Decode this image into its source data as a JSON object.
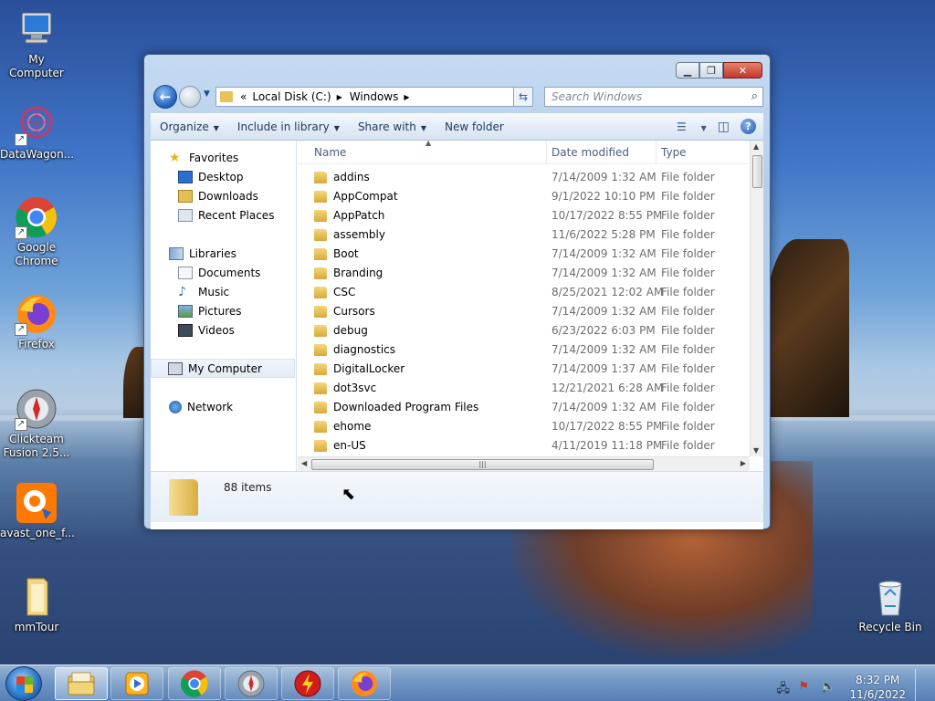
{
  "desktop": {
    "icons": [
      {
        "label": "My Computer",
        "icon": "computer-icon"
      },
      {
        "label": "DataWagon...",
        "icon": "datawagon-icon"
      },
      {
        "label": "Google Chrome",
        "icon": "chrome-icon"
      },
      {
        "label": "Firefox",
        "icon": "firefox-icon"
      },
      {
        "label": "Clickteam Fusion 2.5...",
        "icon": "clickteam-icon"
      },
      {
        "label": "avast_one_f...",
        "icon": "avast-icon"
      },
      {
        "label": "mmTour",
        "icon": "folder-icon"
      },
      {
        "label": "Recycle Bin",
        "icon": "recycle-bin-icon"
      }
    ]
  },
  "window": {
    "breadcrumb": {
      "root_chevron": "«",
      "parts": [
        "Local Disk (C:)",
        "Windows"
      ]
    },
    "search_placeholder": "Search Windows",
    "toolbar": {
      "organize": "Organize",
      "include_in_library": "Include in library",
      "share_with": "Share with",
      "new_folder": "New folder"
    },
    "nav": {
      "favorites": "Favorites",
      "desktop": "Desktop",
      "downloads": "Downloads",
      "recent_places": "Recent Places",
      "libraries": "Libraries",
      "documents": "Documents",
      "music": "Music",
      "pictures": "Pictures",
      "videos": "Videos",
      "my_computer": "My Computer",
      "network": "Network"
    },
    "columns": {
      "name": "Name",
      "date_modified": "Date modified",
      "type": "Type"
    },
    "files": [
      {
        "name": "addins",
        "date": "7/14/2009 1:32 AM",
        "type": "File folder"
      },
      {
        "name": "AppCompat",
        "date": "9/1/2022 10:10 PM",
        "type": "File folder"
      },
      {
        "name": "AppPatch",
        "date": "10/17/2022 8:55 PM",
        "type": "File folder"
      },
      {
        "name": "assembly",
        "date": "11/6/2022 5:28 PM",
        "type": "File folder"
      },
      {
        "name": "Boot",
        "date": "7/14/2009 1:32 AM",
        "type": "File folder"
      },
      {
        "name": "Branding",
        "date": "7/14/2009 1:32 AM",
        "type": "File folder"
      },
      {
        "name": "CSC",
        "date": "8/25/2021 12:02 AM",
        "type": "File folder"
      },
      {
        "name": "Cursors",
        "date": "7/14/2009 1:32 AM",
        "type": "File folder"
      },
      {
        "name": "debug",
        "date": "6/23/2022 6:03 PM",
        "type": "File folder"
      },
      {
        "name": "diagnostics",
        "date": "7/14/2009 1:32 AM",
        "type": "File folder"
      },
      {
        "name": "DigitalLocker",
        "date": "7/14/2009 1:37 AM",
        "type": "File folder"
      },
      {
        "name": "dot3svc",
        "date": "12/21/2021 6:28 AM",
        "type": "File folder"
      },
      {
        "name": "Downloaded Program Files",
        "date": "7/14/2009 1:32 AM",
        "type": "File folder"
      },
      {
        "name": "ehome",
        "date": "10/17/2022 8:55 PM",
        "type": "File folder"
      },
      {
        "name": "en-US",
        "date": "4/11/2019 11:18 PM",
        "type": "File folder"
      }
    ],
    "status": {
      "items_count": "88 items"
    }
  },
  "taskbar": {
    "apps": [
      "explorer-icon",
      "media-player-icon",
      "chrome-icon",
      "clickteam-icon",
      "flash-icon",
      "firefox-icon"
    ],
    "clock": {
      "time": "8:32 PM",
      "date": "11/6/2022"
    }
  }
}
